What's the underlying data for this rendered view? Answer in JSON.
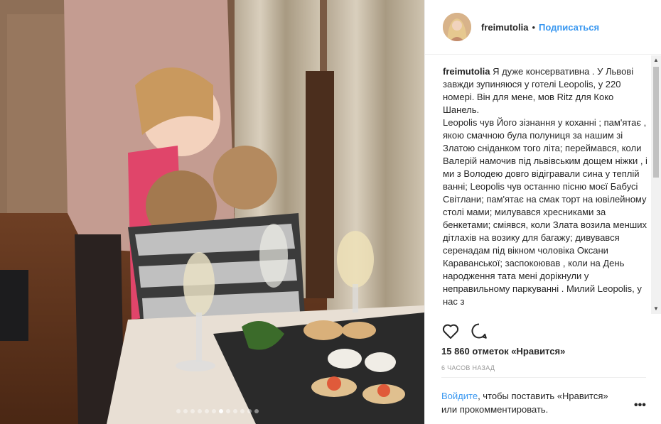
{
  "post": {
    "username": "freimutolia",
    "follow_label": "Подписаться",
    "separator": "•",
    "caption_author": "freimutolia",
    "caption_paragraphs": [
      "Я дуже консервативна . У Львові завжди зупиняюся у готелі Leopolis, у 220 номері. Він для мене, мов Ritz для Коко Шанель.",
      "Leopolis чув Його зізнання у коханні ; пам'ятає , якою смачною була полуниця за нашим зі Златою сніданком того літа; переймався, коли Валерій намочив під львівським дощем ніжки , і ми з Володею довго відігравали сина у теплій ванні; Leopolis чув останню пісню моєї Бабусі Світлани; пам'ятає на смак торт на ювілейному столі мами; милувався хресниками за бенкетами; сміявся, коли Злата возила менших дітлахів на возику для багажу; дивувався серенадам під вікном чоловіка Оксани Караванської; заспокоював , коли на День народження тата мені дорікнули у неправильному паркуванні . Милий Leopolis, у нас з"
    ],
    "likes": "15 860 отметок «Нравится»",
    "time": "6 часов назад",
    "login_link": "Войдите",
    "login_text": ", чтобы поставить «Нравится» или прокомментировать.",
    "more_label": "•••"
  },
  "icons": {
    "like": "heart-icon",
    "comment": "comment-icon",
    "more": "more-options-icon"
  },
  "carousel": {
    "total": 12,
    "active_index": 6
  },
  "colors": {
    "link": "#3897f0",
    "text": "#262626",
    "muted": "#999999"
  }
}
